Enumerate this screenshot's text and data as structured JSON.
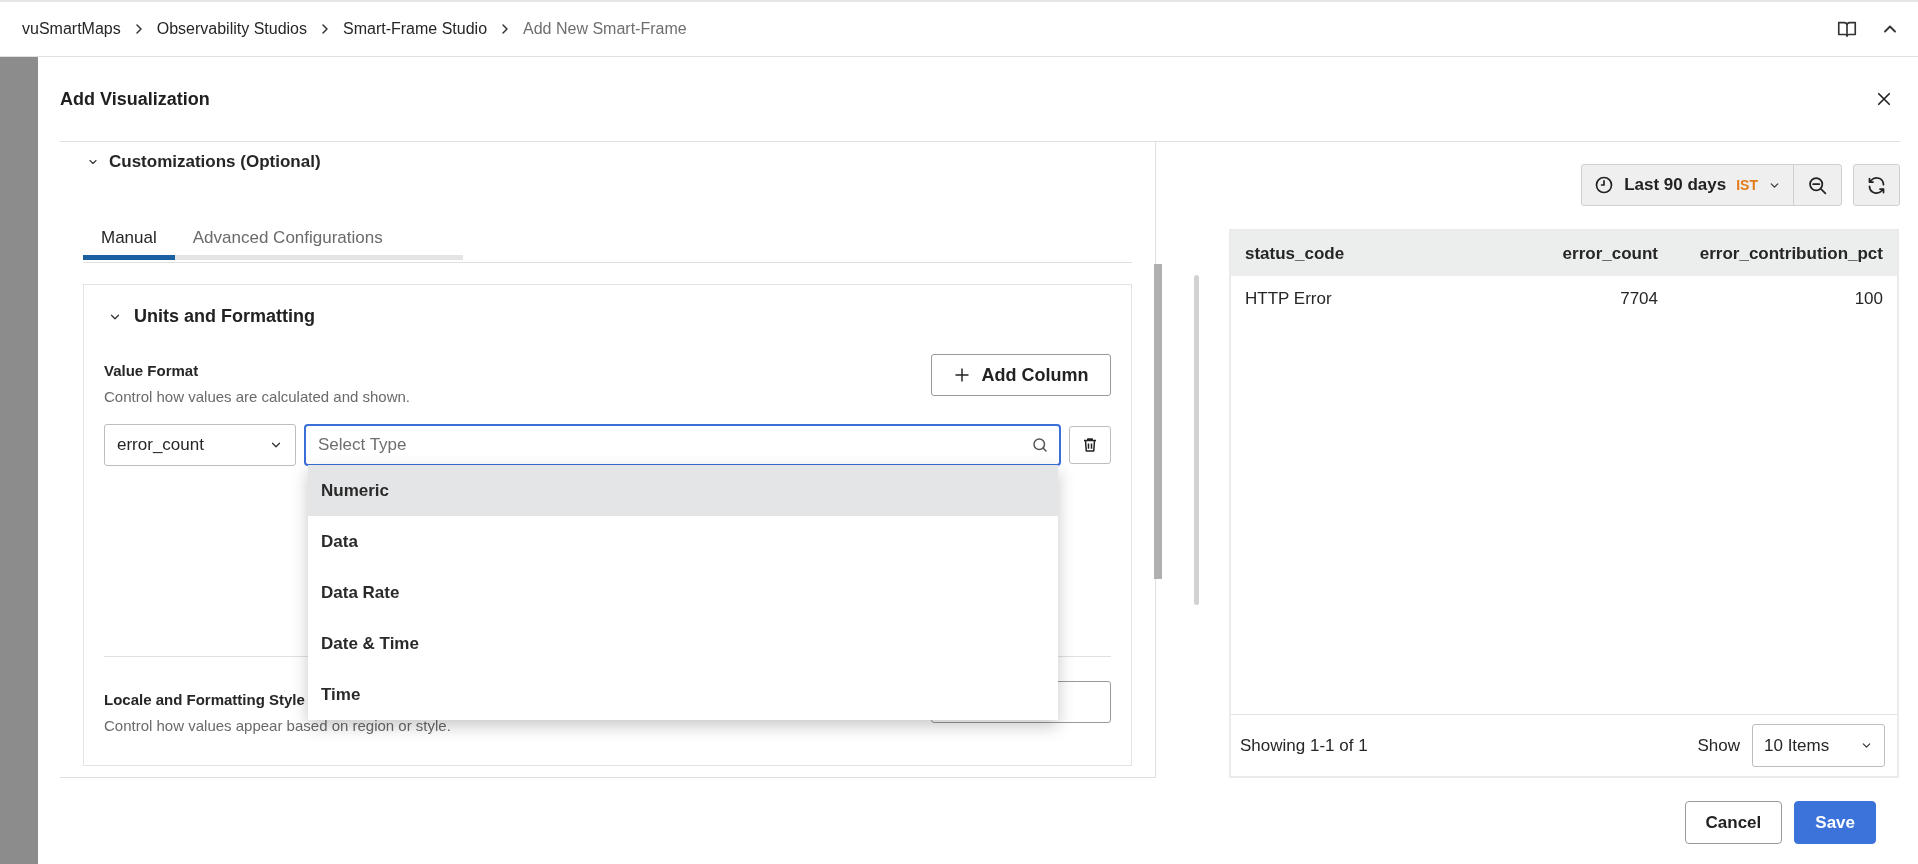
{
  "breadcrumb": [
    {
      "label": "vuSmartMaps",
      "current": false
    },
    {
      "label": "Observability Studios",
      "current": false
    },
    {
      "label": "Smart-Frame Studio",
      "current": false
    },
    {
      "label": "Add New Smart-Frame",
      "current": true
    }
  ],
  "modal": {
    "title": "Add Visualization"
  },
  "customizations": {
    "title": "Customizations (Optional)",
    "expanded": true,
    "tabs": [
      {
        "label": "Manual",
        "selected": true
      },
      {
        "label": "Advanced Configurations",
        "selected": false
      }
    ]
  },
  "units_section": {
    "title": "Units and Formatting",
    "expanded": true,
    "value_format": {
      "title": "Value Format",
      "description": "Control how values are calculated and shown.",
      "add_button": "Add Column",
      "column_select": "error_count",
      "type_field": {
        "placeholder": "Select Type"
      },
      "options": [
        {
          "label": "Numeric",
          "selected": true
        },
        {
          "label": "Data",
          "selected": false
        },
        {
          "label": "Data Rate",
          "selected": false
        },
        {
          "label": "Date & Time",
          "selected": false
        },
        {
          "label": "Time",
          "selected": false
        }
      ]
    },
    "locale": {
      "title": "Locale and Formatting Style",
      "description": "Control how values appear based on region or style."
    }
  },
  "time_range": {
    "label": "Last 90 days",
    "timezone": "IST"
  },
  "table": {
    "columns": [
      "status_code",
      "error_count",
      "error_contribution_pct"
    ],
    "rows": [
      [
        "HTTP Error",
        "7704",
        "100"
      ]
    ],
    "footer": {
      "summary": "Showing 1-1 of 1",
      "show_label": "Show",
      "page_size": "10 Items"
    }
  },
  "buttons": [
    {
      "label": "Cancel",
      "kind": "secondary"
    },
    {
      "label": "Save",
      "kind": "primary"
    }
  ]
}
